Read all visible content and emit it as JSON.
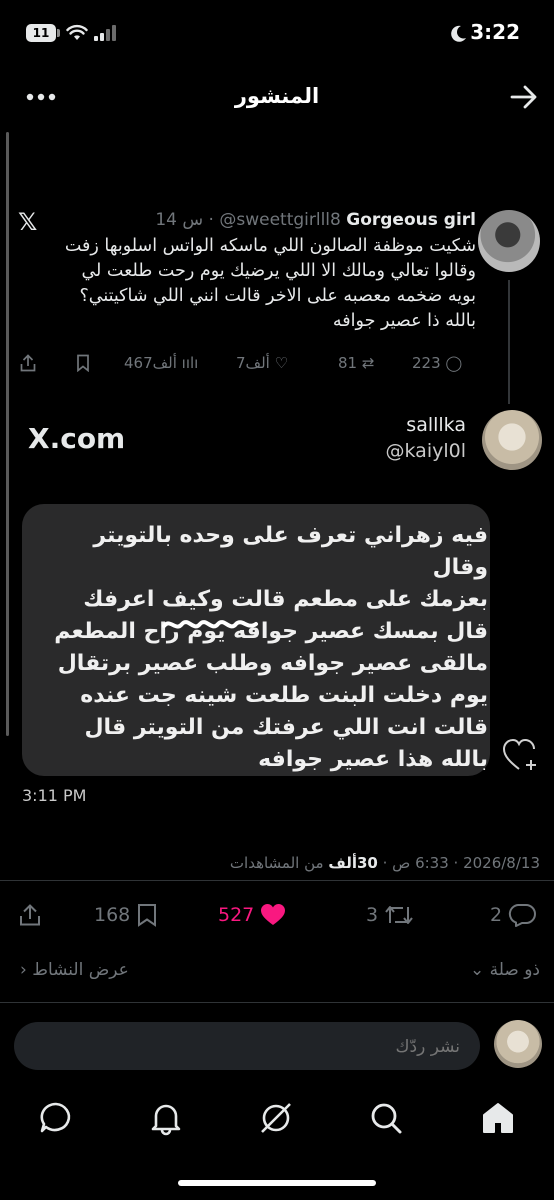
{
  "status_bar": {
    "time": "3:22",
    "battery": "11"
  },
  "header": {
    "title": "المنشور"
  },
  "quoted_tweet": {
    "name": "Gorgeous girl",
    "handle": "@sweettgirlll8",
    "time": "14 س",
    "lines": [
      "شكيت موظفة الصالون اللي ماسكه الواتس اسلوبها زفت",
      "وقالوا تعالي ومالك الا اللي يرضيك يوم رحت طلعت لي",
      "بويه ضخمه معصبه على الاخر قالت انني اللي شاكيتني؟",
      "بالله ذا عصير جوافه"
    ],
    "replies": "223",
    "reposts": "81",
    "likes": "7ألف",
    "views": "467ألف"
  },
  "embedded_screenshot": {
    "name": "salllka",
    "handle": "@kaiyl0l",
    "brand": "X.com",
    "lines": [
      "فيه زهراني تعرف على وحده بالتويتر وقال",
      "بعزمك على مطعم قالت وكيف اعرفك",
      "قال بمسك عصير جوافه يوم راح المطعم",
      "مالقى عصير جوافه وطلب عصير برتقال",
      "يوم دخلت البنت طلعت شينه جت عنده",
      "قالت انت اللي عرفتك من التويتر قال",
      "بالله هذا عصير جوافه"
    ],
    "time": "3:11 PM"
  },
  "post_meta": {
    "date": "2026/8/13",
    "time": "6:33 ص",
    "views_count": "30ألف",
    "views_label": "من المشاهدات"
  },
  "actions": {
    "replies": "2",
    "reposts": "3",
    "likes": "527",
    "bookmarks": "168"
  },
  "links": {
    "related": "ذو صلة",
    "activity": "عرض النشاط"
  },
  "reply": {
    "placeholder": "نشر ردّك"
  },
  "colors": {
    "like": "#f91880",
    "muted": "#71767b",
    "text": "#e7e9ea",
    "background": "#000000"
  }
}
